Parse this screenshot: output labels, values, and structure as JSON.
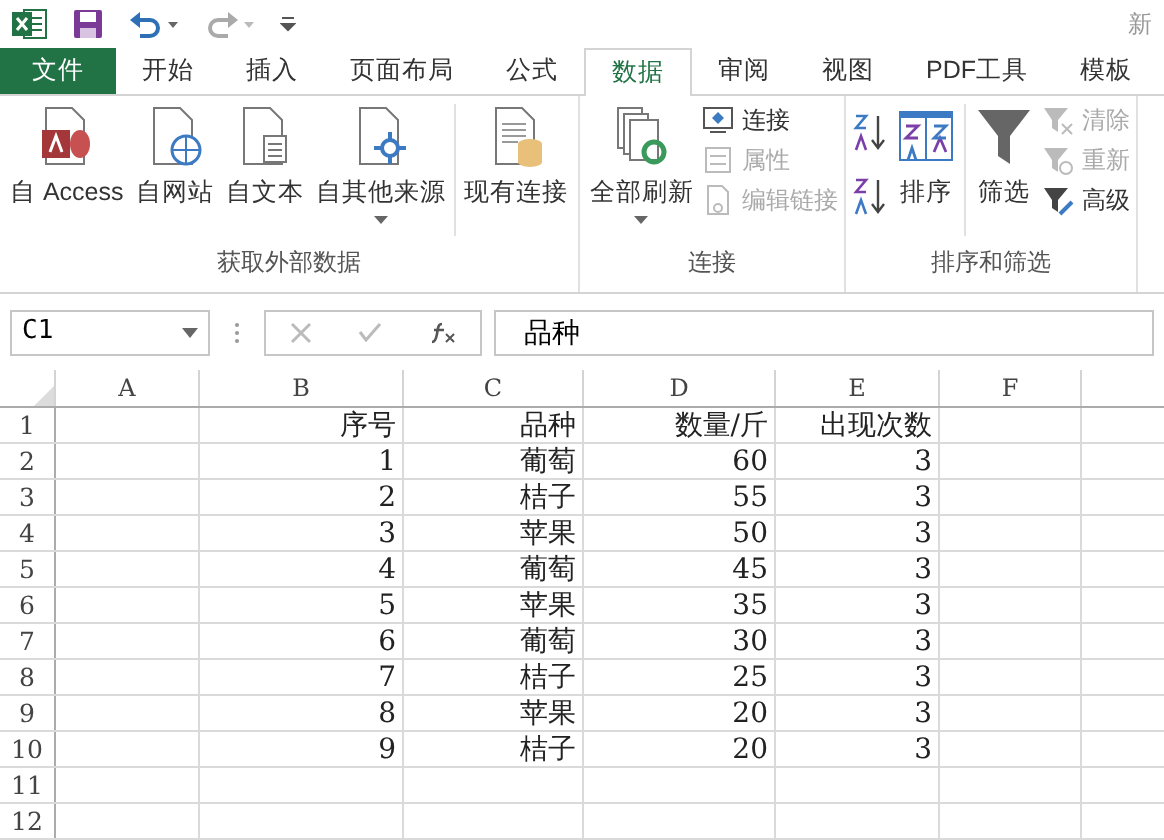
{
  "window": {
    "title": "新"
  },
  "tabs": [
    {
      "label": "文件",
      "kind": "file",
      "selected": false
    },
    {
      "label": "开始",
      "kind": "tab",
      "selected": false
    },
    {
      "label": "插入",
      "kind": "tab",
      "selected": false
    },
    {
      "label": "页面布局",
      "kind": "tab",
      "selected": false
    },
    {
      "label": "公式",
      "kind": "tab",
      "selected": false
    },
    {
      "label": "数据",
      "kind": "tab",
      "selected": true
    },
    {
      "label": "审阅",
      "kind": "tab",
      "selected": false
    },
    {
      "label": "视图",
      "kind": "tab",
      "selected": false
    },
    {
      "label": "PDF工具",
      "kind": "tab",
      "selected": false
    },
    {
      "label": "模板",
      "kind": "tab",
      "selected": false
    }
  ],
  "ribbon": {
    "groups": [
      {
        "label": "获取外部数据",
        "items": [
          {
            "kind": "big",
            "label": "自 Access",
            "caret": false
          },
          {
            "kind": "big",
            "label": "自网站",
            "caret": false
          },
          {
            "kind": "big",
            "label": "自文本",
            "caret": false
          },
          {
            "kind": "big",
            "label": "自其他来源",
            "caret": true
          },
          {
            "kind": "separator"
          },
          {
            "kind": "big",
            "label": "现有连接",
            "caret": false
          }
        ]
      },
      {
        "label": "连接",
        "items": [
          {
            "kind": "big",
            "label": "全部刷新",
            "caret": true
          },
          {
            "kind": "stack",
            "entries": [
              {
                "label": "连接",
                "disabled": false
              },
              {
                "label": "属性",
                "disabled": true
              },
              {
                "label": "编辑链接",
                "disabled": true
              }
            ]
          }
        ]
      },
      {
        "label": "排序和筛选",
        "items": [
          {
            "kind": "sortpair"
          },
          {
            "kind": "big",
            "label": "排序",
            "caret": false
          },
          {
            "kind": "separator"
          },
          {
            "kind": "big",
            "label": "筛选",
            "caret": false
          },
          {
            "kind": "stack",
            "entries": [
              {
                "label": "清除",
                "disabled": true
              },
              {
                "label": "重新",
                "disabled": true
              },
              {
                "label": "高级",
                "disabled": false
              }
            ]
          }
        ]
      }
    ]
  },
  "formula_bar": {
    "name_box": "C1",
    "formula": "品种"
  },
  "sheet": {
    "columns": [
      "A",
      "B",
      "C",
      "D",
      "E",
      "F"
    ],
    "rows": [
      {
        "number": "1",
        "cells": [
          "",
          "序号",
          "品种",
          "数量/斤",
          "出现次数",
          ""
        ]
      },
      {
        "number": "2",
        "cells": [
          "",
          "1",
          "葡萄",
          "60",
          "3",
          ""
        ]
      },
      {
        "number": "3",
        "cells": [
          "",
          "2",
          "桔子",
          "55",
          "3",
          ""
        ]
      },
      {
        "number": "4",
        "cells": [
          "",
          "3",
          "苹果",
          "50",
          "3",
          ""
        ]
      },
      {
        "number": "5",
        "cells": [
          "",
          "4",
          "葡萄",
          "45",
          "3",
          ""
        ]
      },
      {
        "number": "6",
        "cells": [
          "",
          "5",
          "苹果",
          "35",
          "3",
          ""
        ]
      },
      {
        "number": "7",
        "cells": [
          "",
          "6",
          "葡萄",
          "30",
          "3",
          ""
        ]
      },
      {
        "number": "8",
        "cells": [
          "",
          "7",
          "桔子",
          "25",
          "3",
          ""
        ]
      },
      {
        "number": "9",
        "cells": [
          "",
          "8",
          "苹果",
          "20",
          "3",
          ""
        ]
      },
      {
        "number": "10",
        "cells": [
          "",
          "9",
          "桔子",
          "20",
          "3",
          ""
        ]
      },
      {
        "number": "11",
        "cells": [
          "",
          "",
          "",
          "",
          "",
          ""
        ]
      },
      {
        "number": "12",
        "cells": [
          "",
          "",
          "",
          "",
          "",
          ""
        ]
      }
    ]
  }
}
